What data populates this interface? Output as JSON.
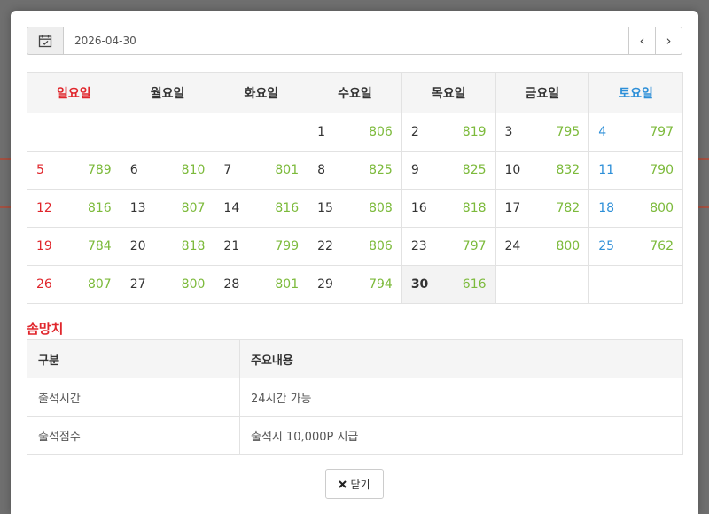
{
  "date_picker": {
    "value": "2026-04-30",
    "prev_icon": "chevron-left-icon",
    "next_icon": "chevron-right-icon",
    "calendar_icon": "calendar-icon"
  },
  "calendar": {
    "weekdays": [
      "일요일",
      "월요일",
      "화요일",
      "수요일",
      "목요일",
      "금요일",
      "토요일"
    ],
    "today": "30",
    "weeks": [
      [
        null,
        null,
        null,
        {
          "day": "1",
          "points": "806"
        },
        {
          "day": "2",
          "points": "819"
        },
        {
          "day": "3",
          "points": "795"
        },
        {
          "day": "4",
          "points": "797"
        }
      ],
      [
        {
          "day": "5",
          "points": "789"
        },
        {
          "day": "6",
          "points": "810"
        },
        {
          "day": "7",
          "points": "801"
        },
        {
          "day": "8",
          "points": "825"
        },
        {
          "day": "9",
          "points": "825"
        },
        {
          "day": "10",
          "points": "832"
        },
        {
          "day": "11",
          "points": "790"
        }
      ],
      [
        {
          "day": "12",
          "points": "816"
        },
        {
          "day": "13",
          "points": "807"
        },
        {
          "day": "14",
          "points": "816"
        },
        {
          "day": "15",
          "points": "808"
        },
        {
          "day": "16",
          "points": "818"
        },
        {
          "day": "17",
          "points": "782"
        },
        {
          "day": "18",
          "points": "800"
        }
      ],
      [
        {
          "day": "19",
          "points": "784"
        },
        {
          "day": "20",
          "points": "818"
        },
        {
          "day": "21",
          "points": "799"
        },
        {
          "day": "22",
          "points": "806"
        },
        {
          "day": "23",
          "points": "797"
        },
        {
          "day": "24",
          "points": "800"
        },
        {
          "day": "25",
          "points": "762"
        }
      ],
      [
        {
          "day": "26",
          "points": "807"
        },
        {
          "day": "27",
          "points": "800"
        },
        {
          "day": "28",
          "points": "801"
        },
        {
          "day": "29",
          "points": "794"
        },
        {
          "day": "30",
          "points": "616"
        },
        null,
        null
      ]
    ]
  },
  "info": {
    "title": "솜망치",
    "headers": [
      "구분",
      "주요내용"
    ],
    "rows": [
      [
        "출석시간",
        "24시간 가능"
      ],
      [
        "출석점수",
        "출석시 10,000P 지급"
      ]
    ]
  },
  "close_button": {
    "label": "닫기",
    "icon": "close-icon"
  },
  "colors": {
    "sunday": "#e0262c",
    "saturday": "#2d8fd8",
    "points": "#7cba3b"
  }
}
